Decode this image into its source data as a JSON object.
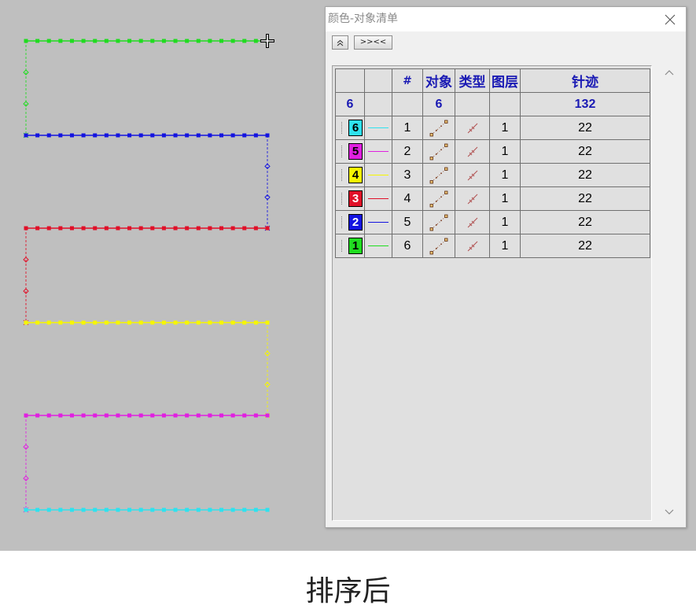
{
  "theme": {
    "canvas_background": "#bfbfbf",
    "header_text": "#1a1ab4",
    "grid_line": "#707070"
  },
  "icons": {
    "close": "close-icon",
    "collapse": "double-chevron-up-icon",
    "scroll_up": "chevron-up-icon",
    "scroll_down": "chevron-down-icon",
    "object": "running-stitch-object-icon",
    "type": "line-type-icon",
    "cursor": "crosshair-cursor-icon"
  },
  "dialog": {
    "title": "颜色-对象清单",
    "toolbar": {
      "sort_label": ">><<"
    },
    "table": {
      "headers": {
        "index": "#",
        "object": "对象",
        "type": "类型",
        "layer": "图层",
        "stitches": "针迹"
      },
      "summary": {
        "color_count": "6",
        "object_count": "6",
        "stitch_total": "132"
      },
      "rows": [
        {
          "color_number": "6",
          "color": "#2ee2ee",
          "number_color": "#000000",
          "index": "1",
          "layer": "1",
          "stitches": "22"
        },
        {
          "color_number": "5",
          "color": "#e020e0",
          "number_color": "#000000",
          "index": "2",
          "layer": "1",
          "stitches": "22"
        },
        {
          "color_number": "4",
          "color": "#f6f600",
          "number_color": "#000000",
          "index": "3",
          "layer": "1",
          "stitches": "22"
        },
        {
          "color_number": "3",
          "color": "#e01028",
          "number_color": "#ffffff",
          "index": "4",
          "layer": "1",
          "stitches": "22"
        },
        {
          "color_number": "2",
          "color": "#1414e0",
          "number_color": "#ffffff",
          "index": "5",
          "layer": "1",
          "stitches": "22"
        },
        {
          "color_number": "1",
          "color": "#20dc20",
          "number_color": "#000000",
          "index": "6",
          "layer": "1",
          "stitches": "22"
        }
      ]
    }
  },
  "caption": "排序后"
}
